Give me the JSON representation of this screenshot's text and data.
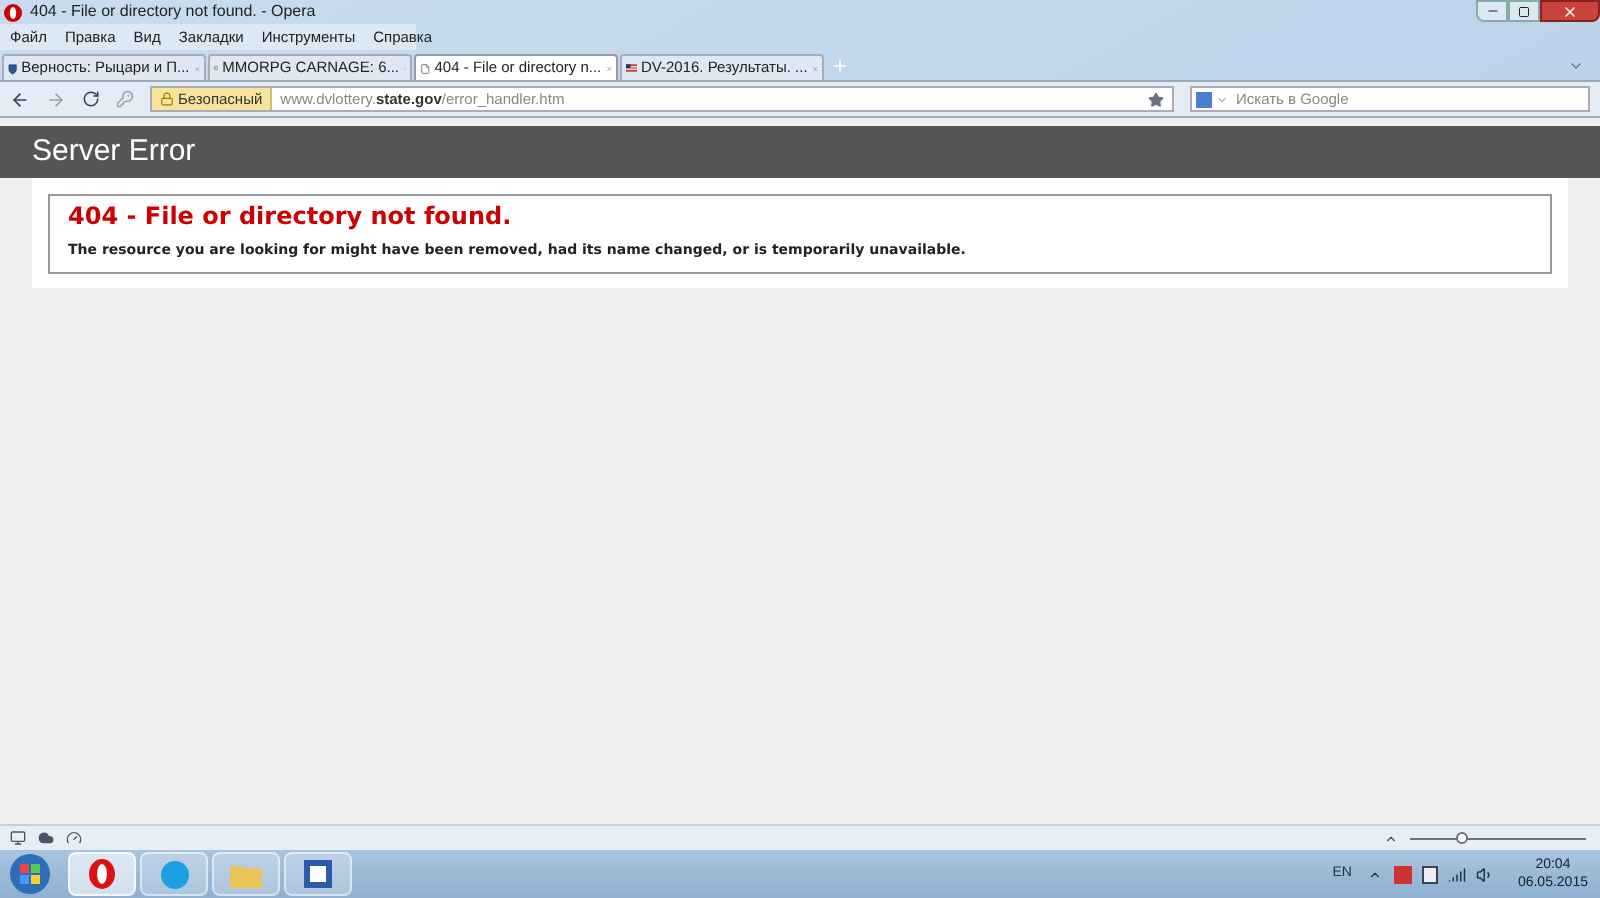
{
  "window": {
    "title": "404 - File or directory not found. - Opera"
  },
  "menu": [
    "Файл",
    "Правка",
    "Вид",
    "Закладки",
    "Инструменты",
    "Справка"
  ],
  "tabs": [
    {
      "label": "Верность: Рыцари и П...",
      "selected": false,
      "kind": "shield"
    },
    {
      "label": "MMORPG CARNAGE: 6...",
      "selected": false,
      "kind": "game"
    },
    {
      "label": "404 - File or directory n...",
      "selected": true,
      "kind": "page"
    },
    {
      "label": "DV-2016. Результаты. ...",
      "selected": false,
      "kind": "flag"
    }
  ],
  "address_bar": {
    "security": "Безопасный",
    "url": "www.dvlottery.**state.gov**/error_handler.htm"
  },
  "search": {
    "placeholder": "Искать в Google"
  },
  "page": {
    "header": "Server Error",
    "error_title": "404 - File or directory not found.",
    "error_message": "The resource you are looking for might have been removed, had its name changed, or is temporarily unavailable."
  },
  "status_bar": {
    "zoom": {
      "level": 0.3
    }
  },
  "taskbar": {
    "language": "EN",
    "time": "20:04",
    "date": "06.05.2015"
  }
}
